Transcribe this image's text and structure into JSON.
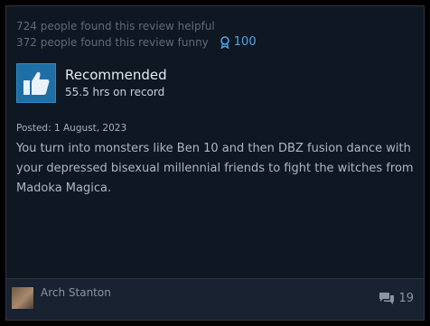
{
  "helpful": {
    "helpful_text": "724 people found this review helpful",
    "funny_text": "372 people found this review funny",
    "award_count": "100",
    "award_icon": "award-ribbon-icon"
  },
  "recommendation": {
    "icon": "thumbs-up-icon",
    "label": "Recommended",
    "hours": "55.5 hrs on record"
  },
  "posted": "Posted: 1 August, 2023",
  "review_text": "You turn into monsters like Ben 10 and then DBZ fusion dance with your depressed bisexual millennial friends to fight the witches from Madoka Magica.",
  "footer": {
    "author": "Arch Stanton",
    "comment_count": "19",
    "comment_icon": "comments-icon"
  },
  "colors": {
    "card_bg": "#0f1722",
    "accent": "#4fa6e8",
    "thumb_bg": "#1f6fa7",
    "footer_bg": "#182230"
  }
}
